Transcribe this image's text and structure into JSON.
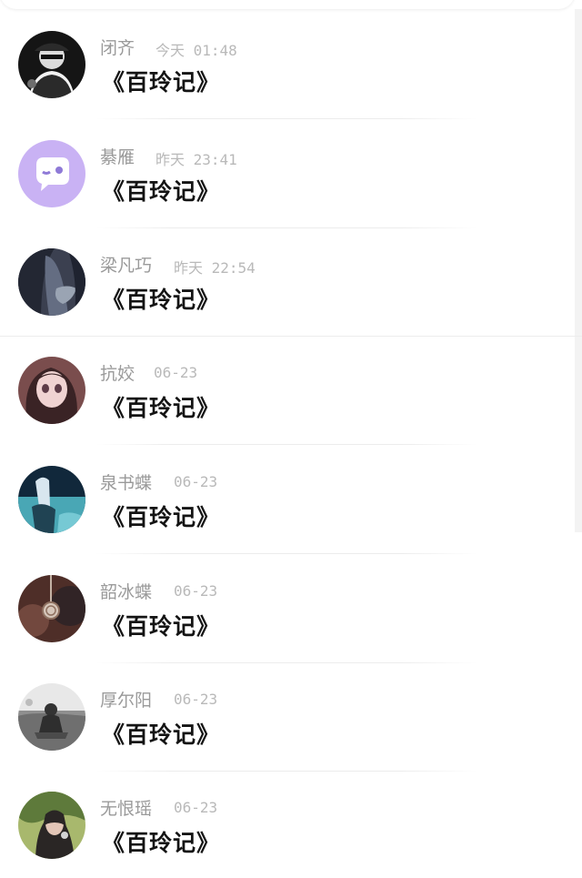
{
  "feed": {
    "posts": [
      {
        "author": "闭齐",
        "time": "今天 01:48",
        "message": "《百玲记》",
        "avatar": "avatar-hat-person"
      },
      {
        "author": "綦雁",
        "time": "昨天 23:41",
        "message": "《百玲记》",
        "avatar": "avatar-chat-bubble"
      },
      {
        "author": "梁凡巧",
        "time": "昨天 22:54",
        "message": "《百玲记》",
        "avatar": "avatar-dark-clothing"
      },
      {
        "author": "抗姣",
        "time": "06-23",
        "message": "《百玲记》",
        "avatar": "avatar-anime-girl"
      },
      {
        "author": "泉书蝶",
        "time": "06-23",
        "message": "《百玲记》",
        "avatar": "avatar-blue-figure"
      },
      {
        "author": "韶冰蝶",
        "time": "06-23",
        "message": "《百玲记》",
        "avatar": "avatar-pocket-watch"
      },
      {
        "author": "厚尔阳",
        "time": "06-23",
        "message": "《百玲记》",
        "avatar": "avatar-grass-child"
      },
      {
        "author": "无恨瑶",
        "time": "06-23",
        "message": "《百玲记》",
        "avatar": "avatar-portrait-woman"
      }
    ]
  },
  "colors": {
    "name": "#9a9a9a",
    "time": "#b9b9b9",
    "message": "#141414",
    "purple": "#c9b2f4"
  }
}
